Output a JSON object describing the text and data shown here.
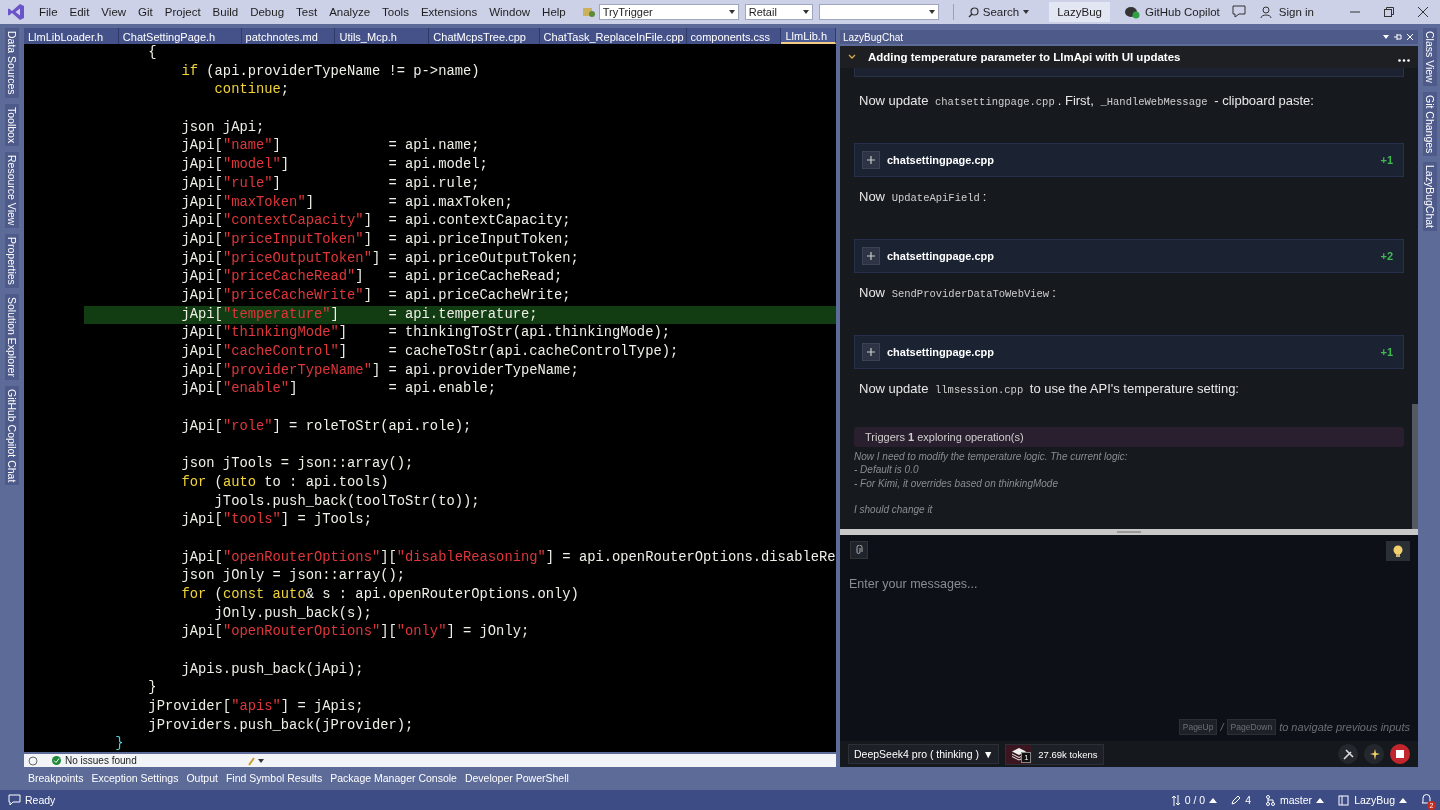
{
  "title_bar": {
    "menus": [
      "File",
      "Edit",
      "View",
      "Git",
      "Project",
      "Build",
      "Debug",
      "Test",
      "Analyze",
      "Tools",
      "Extensions",
      "Window",
      "Help"
    ],
    "combos": [
      {
        "kind": "text",
        "value": "TryTrigger"
      },
      {
        "kind": "text",
        "value": "Retail"
      },
      {
        "kind": "empty"
      }
    ],
    "search": "Search",
    "solution": "LazyBug",
    "copilot": "GitHub Copilot",
    "sign_in": "Sign in"
  },
  "left_tool_tabs": [
    "Data Sources",
    "Toolbox",
    "Resource View",
    "Properties",
    "Solution Explorer",
    "GitHub Copilot Chat"
  ],
  "right_tool_tabs": [
    "Class View",
    "Git Changes",
    "LazyBugChat"
  ],
  "editor": {
    "tabs": [
      {
        "label": "LlmLibLoader.h",
        "selected": false
      },
      {
        "label": "ChatSettingPage.h",
        "selected": false
      },
      {
        "label": "patchnotes.md",
        "selected": false
      },
      {
        "label": "Utils_Mcp.h",
        "selected": false
      },
      {
        "label": "ChatMcpsTree.cpp",
        "selected": false
      },
      {
        "label": "ChatTask_ReplaceInFile.cpp",
        "selected": false
      },
      {
        "label": "components.css",
        "selected": false
      },
      {
        "label": "LlmLib.h",
        "selected": true
      }
    ],
    "lines": [
      {
        "kind": "code",
        "highlighted": false,
        "spans": [
          {
            "text": "            {",
            "kind": "plain"
          }
        ]
      },
      {
        "kind": "code",
        "highlighted": false,
        "spans": [
          {
            "text": "                if",
            "kind": "kw"
          },
          {
            "text": " (api.providerTypeName != p->name)",
            "kind": "plain"
          }
        ]
      },
      {
        "kind": "code",
        "highlighted": false,
        "spans": [
          {
            "text": "                    continue",
            "kind": "kw"
          },
          {
            "text": ";",
            "kind": "plain"
          }
        ]
      },
      {
        "kind": "blank"
      },
      {
        "kind": "code",
        "highlighted": false,
        "spans": [
          {
            "text": "                json jApi;",
            "kind": "plain"
          }
        ]
      },
      {
        "kind": "code",
        "highlighted": false,
        "spans": [
          {
            "text": "                jApi[",
            "kind": "plain"
          },
          {
            "text": "\"name\"",
            "kind": "str"
          },
          {
            "text": "]             = api.name;",
            "kind": "plain"
          }
        ]
      },
      {
        "kind": "code",
        "highlighted": false,
        "spans": [
          {
            "text": "                jApi[",
            "kind": "plain"
          },
          {
            "text": "\"model\"",
            "kind": "str"
          },
          {
            "text": "]            = api.model;",
            "kind": "plain"
          }
        ]
      },
      {
        "kind": "code",
        "highlighted": false,
        "spans": [
          {
            "text": "                jApi[",
            "kind": "plain"
          },
          {
            "text": "\"rule\"",
            "kind": "str"
          },
          {
            "text": "]             = api.rule;",
            "kind": "plain"
          }
        ]
      },
      {
        "kind": "code",
        "highlighted": false,
        "spans": [
          {
            "text": "                jApi[",
            "kind": "plain"
          },
          {
            "text": "\"maxToken\"",
            "kind": "str"
          },
          {
            "text": "]         = api.maxToken;",
            "kind": "plain"
          }
        ]
      },
      {
        "kind": "code",
        "highlighted": false,
        "spans": [
          {
            "text": "                jApi[",
            "kind": "plain"
          },
          {
            "text": "\"contextCapacity\"",
            "kind": "str"
          },
          {
            "text": "]  = api.contextCapacity;",
            "kind": "plain"
          }
        ]
      },
      {
        "kind": "code",
        "highlighted": false,
        "spans": [
          {
            "text": "                jApi[",
            "kind": "plain"
          },
          {
            "text": "\"priceInputToken\"",
            "kind": "str"
          },
          {
            "text": "]  = api.priceInputToken;",
            "kind": "plain"
          }
        ]
      },
      {
        "kind": "code",
        "highlighted": false,
        "spans": [
          {
            "text": "                jApi[",
            "kind": "plain"
          },
          {
            "text": "\"priceOutputToken\"",
            "kind": "str"
          },
          {
            "text": "] = api.priceOutputToken;",
            "kind": "plain"
          }
        ]
      },
      {
        "kind": "code",
        "highlighted": false,
        "spans": [
          {
            "text": "                jApi[",
            "kind": "plain"
          },
          {
            "text": "\"priceCacheRead\"",
            "kind": "str"
          },
          {
            "text": "]   = api.priceCacheRead;",
            "kind": "plain"
          }
        ]
      },
      {
        "kind": "code",
        "highlighted": false,
        "spans": [
          {
            "text": "                jApi[",
            "kind": "plain"
          },
          {
            "text": "\"priceCacheWrite\"",
            "kind": "str"
          },
          {
            "text": "]  = api.priceCacheWrite;",
            "kind": "plain"
          }
        ]
      },
      {
        "kind": "code",
        "highlighted": true,
        "spans": [
          {
            "text": "                jApi[",
            "kind": "plain"
          },
          {
            "text": "\"temperature\"",
            "kind": "str"
          },
          {
            "text": "]      = api.temperature;",
            "kind": "plain"
          }
        ]
      },
      {
        "kind": "code",
        "highlighted": false,
        "spans": [
          {
            "text": "                jApi[",
            "kind": "plain"
          },
          {
            "text": "\"thinkingMode\"",
            "kind": "str"
          },
          {
            "text": "]     = thinkingToStr(api.thinkingMode);",
            "kind": "plain"
          }
        ]
      },
      {
        "kind": "code",
        "highlighted": false,
        "spans": [
          {
            "text": "                jApi[",
            "kind": "plain"
          },
          {
            "text": "\"cacheControl\"",
            "kind": "str"
          },
          {
            "text": "]     = cacheToStr(api.cacheControlType);",
            "kind": "plain"
          }
        ]
      },
      {
        "kind": "code",
        "highlighted": false,
        "spans": [
          {
            "text": "                jApi[",
            "kind": "plain"
          },
          {
            "text": "\"providerTypeName\"",
            "kind": "str"
          },
          {
            "text": "] = api.providerTypeName;",
            "kind": "plain"
          }
        ]
      },
      {
        "kind": "code",
        "highlighted": false,
        "spans": [
          {
            "text": "                jApi[",
            "kind": "plain"
          },
          {
            "text": "\"enable\"",
            "kind": "str"
          },
          {
            "text": "]           = api.enable;",
            "kind": "plain"
          }
        ]
      },
      {
        "kind": "blank"
      },
      {
        "kind": "code",
        "highlighted": false,
        "spans": [
          {
            "text": "                jApi[",
            "kind": "plain"
          },
          {
            "text": "\"role\"",
            "kind": "str"
          },
          {
            "text": "] = roleToStr(api.role);",
            "kind": "plain"
          }
        ]
      },
      {
        "kind": "blank"
      },
      {
        "kind": "code",
        "highlighted": false,
        "spans": [
          {
            "text": "                json jTools = json::array();",
            "kind": "plain"
          }
        ]
      },
      {
        "kind": "code",
        "highlighted": false,
        "spans": [
          {
            "text": "                for",
            "kind": "kw"
          },
          {
            "text": " (",
            "kind": "plain"
          },
          {
            "text": "auto",
            "kind": "kw"
          },
          {
            "text": " to : api.tools)",
            "kind": "plain"
          }
        ]
      },
      {
        "kind": "code",
        "highlighted": false,
        "spans": [
          {
            "text": "                    jTools.push_back(toolToStr(to));",
            "kind": "plain"
          }
        ]
      },
      {
        "kind": "code",
        "highlighted": false,
        "spans": [
          {
            "text": "                jApi[",
            "kind": "plain"
          },
          {
            "text": "\"tools\"",
            "kind": "str"
          },
          {
            "text": "] = jTools;",
            "kind": "plain"
          }
        ]
      },
      {
        "kind": "blank"
      },
      {
        "kind": "code",
        "highlighted": false,
        "spans": [
          {
            "text": "                jApi[",
            "kind": "plain"
          },
          {
            "text": "\"openRouterOptions\"",
            "kind": "str"
          },
          {
            "text": "][",
            "kind": "plain"
          },
          {
            "text": "\"disableReasoning\"",
            "kind": "str"
          },
          {
            "text": "] = api.openRouterOptions.disableRe",
            "kind": "plain"
          }
        ]
      },
      {
        "kind": "code",
        "highlighted": false,
        "spans": [
          {
            "text": "                json jOnly = json::array();",
            "kind": "plain"
          }
        ]
      },
      {
        "kind": "code",
        "highlighted": false,
        "spans": [
          {
            "text": "                for",
            "kind": "kw"
          },
          {
            "text": " (",
            "kind": "plain"
          },
          {
            "text": "const auto",
            "kind": "kw"
          },
          {
            "text": "& s : api.openRouterOptions.only)",
            "kind": "plain"
          }
        ]
      },
      {
        "kind": "code",
        "highlighted": false,
        "spans": [
          {
            "text": "                    jOnly.push_back(s);",
            "kind": "plain"
          }
        ]
      },
      {
        "kind": "code",
        "highlighted": false,
        "spans": [
          {
            "text": "                jApi[",
            "kind": "plain"
          },
          {
            "text": "\"openRouterOptions\"",
            "kind": "str"
          },
          {
            "text": "][",
            "kind": "plain"
          },
          {
            "text": "\"only\"",
            "kind": "str"
          },
          {
            "text": "] = jOnly;",
            "kind": "plain"
          }
        ]
      },
      {
        "kind": "blank"
      },
      {
        "kind": "code",
        "highlighted": false,
        "spans": [
          {
            "text": "                jApis.push_back(jApi);",
            "kind": "plain"
          }
        ]
      },
      {
        "kind": "code",
        "highlighted": false,
        "spans": [
          {
            "text": "            }",
            "kind": "plain"
          }
        ]
      },
      {
        "kind": "code",
        "highlighted": false,
        "spans": [
          {
            "text": "            jProvider[",
            "kind": "plain"
          },
          {
            "text": "\"apis\"",
            "kind": "str"
          },
          {
            "text": "] = jApis;",
            "kind": "plain"
          }
        ]
      },
      {
        "kind": "code",
        "highlighted": false,
        "spans": [
          {
            "text": "            jProviders.push_back(jProvider);",
            "kind": "plain"
          }
        ]
      },
      {
        "kind": "code",
        "highlighted": false,
        "spans": [
          {
            "text": "        }",
            "kind": "cyan"
          }
        ]
      }
    ],
    "status": "No issues found"
  },
  "chat": {
    "panel_title": "LazyBugChat",
    "title": "Adding temperature parameter to LlmApi with UI updates",
    "messages": [
      {
        "kind": "text",
        "parts": [
          {
            "kind": "text",
            "text": "Now update "
          },
          {
            "kind": "code",
            "text": "chatsettingpage.cpp"
          },
          {
            "kind": "text",
            "text": ". First, "
          },
          {
            "kind": "code",
            "text": "_HandleWebMessage"
          },
          {
            "kind": "text",
            "text": " - clipboard paste:"
          }
        ]
      },
      {
        "kind": "file",
        "name": "chatsettingpage.cpp",
        "delta": "+1"
      },
      {
        "kind": "text",
        "parts": [
          {
            "kind": "text",
            "text": "Now "
          },
          {
            "kind": "code",
            "text": "UpdateApiField"
          },
          {
            "kind": "text",
            "text": ":"
          }
        ]
      },
      {
        "kind": "file",
        "name": "chatsettingpage.cpp",
        "delta": "+2"
      },
      {
        "kind": "text",
        "parts": [
          {
            "kind": "text",
            "text": "Now "
          },
          {
            "kind": "code",
            "text": "SendProviderDataToWebView"
          },
          {
            "kind": "text",
            "text": ":"
          }
        ]
      },
      {
        "kind": "file",
        "name": "chatsettingpage.cpp",
        "delta": "+1"
      },
      {
        "kind": "text",
        "parts": [
          {
            "kind": "text",
            "text": "Now update "
          },
          {
            "kind": "code",
            "text": "llmsession.cpp"
          },
          {
            "kind": "text",
            "text": " to use the API's temperature setting:"
          }
        ]
      },
      {
        "kind": "trigger",
        "text": "Triggers **1** exploring operation(s)"
      },
      {
        "kind": "thinking",
        "paragraphs": [
          [
            "Now I need to modify the temperature logic. The current logic:",
            "- Default is 0.0",
            "- For Kimi, it overrides based on thinkingMode"
          ],
          [
            "I should change it"
          ]
        ]
      }
    ],
    "input": {
      "placeholder": "Enter your messages..."
    },
    "hint": {
      "keys": [
        "PageUp",
        "PageDown"
      ],
      "separator": "/",
      "text": "to navigate previous inputs"
    },
    "model": "DeepSeek4 pro ( thinking )",
    "model_caret": "▼",
    "context_count": "1",
    "tokens": "27.69k tokens"
  },
  "bottom_tabs": [
    "Breakpoints",
    "Exception Settings",
    "Output",
    "Find Symbol Results",
    "Package Manager Console",
    "Developer PowerShell"
  ],
  "status_bar": {
    "text": "Ready",
    "sync": "0 / 0",
    "edits": "4",
    "branch": "master",
    "repo": "LazyBug",
    "notifications": "2"
  }
}
